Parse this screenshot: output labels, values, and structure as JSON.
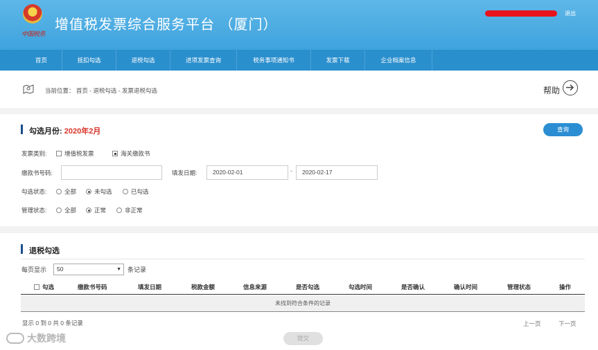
{
  "header": {
    "emblem_text": "中国税务",
    "title": "增值税发票综合服务平台 （厦门）",
    "logout": "退出"
  },
  "nav": {
    "items": [
      {
        "label": "首页"
      },
      {
        "label": "抵扣勾选"
      },
      {
        "label": "退税勾选"
      },
      {
        "label": "进项发票查询"
      },
      {
        "label": "税务事项通知书"
      },
      {
        "label": "发票下载"
      },
      {
        "label": "企业档案信息"
      }
    ]
  },
  "breadcrumb": {
    "text": "当前位置： 首页 - 退税勾选 - 发票退税勾选",
    "help": "帮助"
  },
  "filter": {
    "month_label": "勾选月份:",
    "month_value": "2020年2月",
    "query_button": "查询",
    "invoice_type_label": "发票类别:",
    "invoice_type_options": [
      "增值税发票",
      "海关缴款书"
    ],
    "invoice_type_selected": "海关缴款书",
    "payment_no_label": "缴款书号码:",
    "payment_no_value": "",
    "fill_date_label": "填发日期:",
    "date_from": "2020-02-01",
    "date_to": "2020-02-17",
    "date_separator": "-",
    "select_status_label": "勾选状态:",
    "select_status_options": [
      "全部",
      "未勾选",
      "已勾选"
    ],
    "select_status_selected": "未勾选",
    "manage_status_label": "管理状态:",
    "manage_status_options": [
      "全部",
      "正常",
      "非正常"
    ],
    "manage_status_selected": "正常"
  },
  "list": {
    "title": "退税勾选",
    "per_page_prefix": "每页显示",
    "per_page_value": "50",
    "per_page_suffix": "条记录",
    "columns": [
      "勾选",
      "缴款书号码",
      "填发日期",
      "税款金额",
      "信息来源",
      "是否勾选",
      "勾选时间",
      "是否确认",
      "确认时间",
      "管理状态",
      "操作"
    ],
    "empty_message": "未找到符合条件的记录",
    "summary": "显示 0 到 0 共 0 条记录",
    "prev": "上一页",
    "next": "下一页",
    "submit": "提交"
  },
  "watermark": "大数跨境"
}
